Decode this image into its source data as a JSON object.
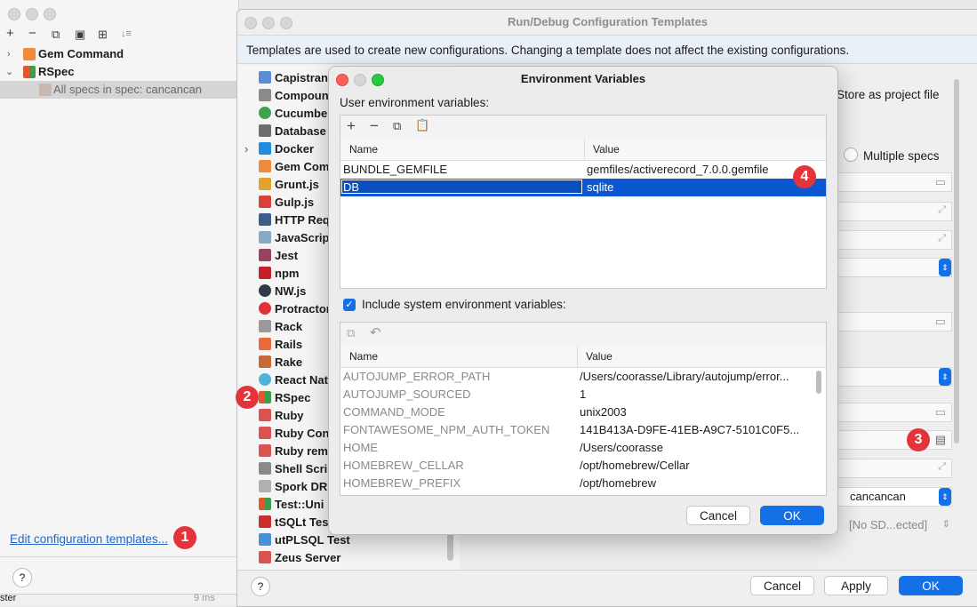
{
  "back_window": {
    "toolbar": [
      "+",
      "−",
      "⧉",
      "▣",
      "⊞",
      "↓≡"
    ],
    "tree": [
      {
        "label": "Gem Command",
        "bold": true
      },
      {
        "label": "RSpec",
        "bold": true
      },
      {
        "label": "All specs in spec: cancancan",
        "bold": false
      }
    ],
    "edit_link": "Edit configuration templates...",
    "help": "?",
    "bottom_text": "ster",
    "bottom_right": "9 ms"
  },
  "templates_window": {
    "title": "Run/Debug Configuration Templates",
    "info": "Templates are used to create new configurations. Changing a template does not affect the existing configurations.",
    "items": [
      "Capistrano",
      "Compound",
      "Cucumber",
      "Database",
      "Docker",
      "Gem Com",
      "Grunt.js",
      "Gulp.js",
      "HTTP Req",
      "JavaScrip",
      "Jest",
      "npm",
      "NW.js",
      "Protractor",
      "Rack",
      "Rails",
      "Rake",
      "React Nat",
      "RSpec",
      "Ruby",
      "Ruby Con",
      "Ruby rem",
      "Shell Scri",
      "Spork DR",
      "Test::Uni",
      "tSQLt Tes",
      "utPLSQL Test",
      "Zeus Server"
    ],
    "store_as_project": "Store as project file",
    "multiple_specs": "Multiple specs",
    "sdk_value": "cancancan",
    "sdk_placeholder": "[No SD...ected]",
    "buttons": {
      "cancel": "Cancel",
      "apply": "Apply",
      "ok": "OK"
    },
    "help": "?"
  },
  "env_dialog": {
    "title": "Environment Variables",
    "user_label": "User environment variables:",
    "user_toolbar": [
      "+",
      "−",
      "⧉",
      "📋"
    ],
    "columns": {
      "name": "Name",
      "value": "Value"
    },
    "user_vars": [
      {
        "name": "BUNDLE_GEMFILE",
        "value": "gemfiles/activerecord_7.0.0.gemfile"
      },
      {
        "name": "DB",
        "value": "sqlite"
      }
    ],
    "include_system_label": "Include system environment variables:",
    "include_system_checked": true,
    "system_vars": [
      {
        "name": "AUTOJUMP_ERROR_PATH",
        "value": "/Users/coorasse/Library/autojump/error..."
      },
      {
        "name": "AUTOJUMP_SOURCED",
        "value": "1"
      },
      {
        "name": "COMMAND_MODE",
        "value": "unix2003"
      },
      {
        "name": "FONTAWESOME_NPM_AUTH_TOKEN",
        "value": "141B413A-D9FE-41EB-A9C7-5101C0F5..."
      },
      {
        "name": "HOME",
        "value": "/Users/coorasse"
      },
      {
        "name": "HOMEBREW_CELLAR",
        "value": "/opt/homebrew/Cellar"
      },
      {
        "name": "HOMEBREW_PREFIX",
        "value": "/opt/homebrew"
      }
    ],
    "buttons": {
      "cancel": "Cancel",
      "ok": "OK"
    }
  },
  "badges": [
    "1",
    "2",
    "3",
    "4"
  ],
  "colors": {
    "accent": "#1470e6",
    "badge": "#e5333b",
    "selection": "#0b57d0"
  }
}
